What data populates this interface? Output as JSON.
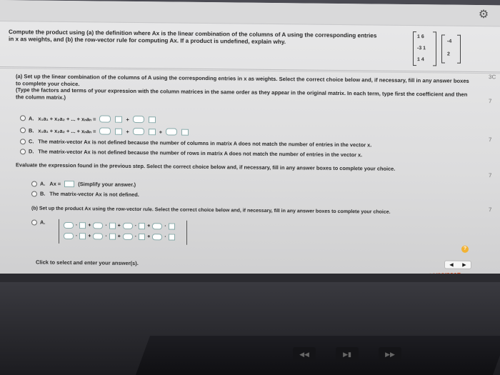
{
  "question": "Compute the product using (a) the definition where Ax is the linear combination of the columns of A using the corresponding entries in x as weights, and (b) the row-vector rule for computing Ax. If a product is undefined, explain why.",
  "matrix": {
    "rows": [
      "1  6",
      "-3  1",
      "1  4"
    ],
    "vector": [
      "-4",
      "2"
    ]
  },
  "part_a": {
    "instruction": "(a) Set up the linear combination of the columns of A using the corresponding entries in x as weights. Select the correct choice below and, if necessary, fill in any answer boxes to complete your choice.",
    "hint": "(Type the factors and terms of your expression with the column matrices in the same order as they appear in the original matrix. In each term, type first the coefficient and then the column matrix.)",
    "choices": [
      {
        "letter": "A.",
        "text": "x₁a₁ + x₂a₂ + ... + xₙaₙ ="
      },
      {
        "letter": "B.",
        "text": "x₁a₁ + x₂a₂ + ... + xₙaₙ ="
      },
      {
        "letter": "C.",
        "text": "The matrix-vector Ax is not defined because the number of columns in matrix A does not match the number of entries in the vector x."
      },
      {
        "letter": "D.",
        "text": "The matrix-vector Ax is not defined because the number of rows in matrix A does not match the number of entries in the vector x."
      }
    ]
  },
  "evaluate": {
    "instruction": "Evaluate the expression found in the previous step. Select the correct choice below and, if necessary, fill in any answer boxes to complete your choice.",
    "choices": [
      {
        "letter": "A.",
        "text": "Ax =",
        "suffix": "(Simplify your answer.)"
      },
      {
        "letter": "B.",
        "text": "The matrix-vector Ax is not defined."
      }
    ]
  },
  "part_b": {
    "instruction": "(b) Set up the product Ax using the row-vector rule. Select the correct choice below and, if necessary, fill in any answer boxes to complete your choice.",
    "choice_letter": "A."
  },
  "footer": "Click to select and enter your answer(s).",
  "date_stamp": "09/29/2017",
  "help_icon": "?",
  "accent_color": "#e65a2c"
}
